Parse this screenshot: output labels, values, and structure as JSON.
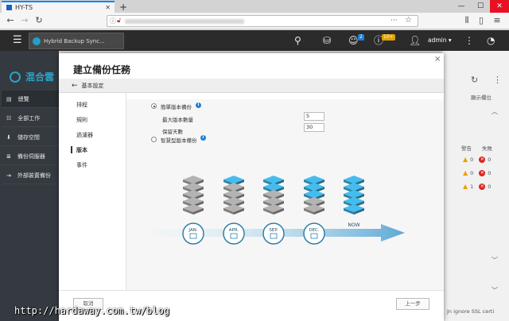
{
  "browser": {
    "tab_title": "HY-TS",
    "tab_close": "✕",
    "new_tab": "+",
    "minimize": "—",
    "maximize": "☐",
    "close": "✕"
  },
  "qts": {
    "app_tab": "Hybrid Backup Sync...",
    "notif_badge": "2",
    "event_badge": "10+",
    "user": "admin ▾"
  },
  "bg_app": {
    "logo": "混合雲",
    "sidebar": [
      "總覽",
      "全部工作",
      "儲存空間",
      "備份伺服器",
      "外部裝置備份"
    ],
    "right_label": "顯示欄位",
    "col_warn": "警告",
    "col_fail": "失敗",
    "rows": [
      {
        "warn": "0",
        "fail": "0"
      },
      {
        "warn": "0",
        "fail": "0"
      },
      {
        "warn": "1",
        "fail": "0"
      }
    ],
    "bottom_text": "Jn ignore SSL certi"
  },
  "modal": {
    "title": "建立備份任務",
    "close": "×",
    "breadcrumb": "基本設定",
    "nav": [
      "排程",
      "規則",
      "過濾器",
      "版本",
      "事件"
    ],
    "active_nav": "版本",
    "option_simple": "簡單版本備份",
    "max_versions_label": "最大版本數量",
    "max_versions": "5",
    "retention_label": "保留天數",
    "retention_days": "30",
    "option_smart": "智慧型版本備份",
    "months": [
      "JAN.",
      "APR.",
      "SEP.",
      "DEC."
    ],
    "now": "NOW",
    "cancel": "取消",
    "prev": "上一步"
  },
  "watermark": "http://hardaway.com.tw/blog",
  "colors": {
    "accent": "#2aa3c6",
    "stack_gray": "#9c9c9c",
    "stack_blue": "#3ba4cf",
    "arrow": "#5ea9d6",
    "error": "#d9261c",
    "warning": "#f0a000"
  }
}
